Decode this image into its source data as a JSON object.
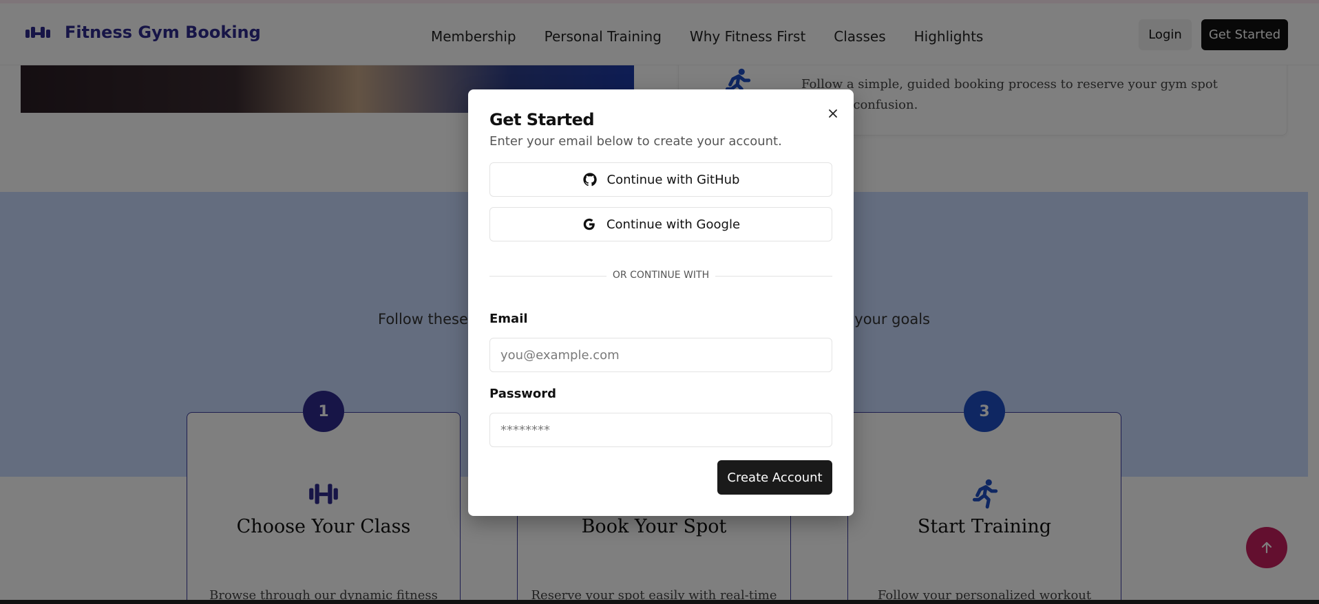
{
  "header": {
    "brand_name": "Fitness Gym Booking",
    "nav": [
      "Membership",
      "Personal Training",
      "Why Fitness First",
      "Classes",
      "Highlights"
    ],
    "login_label": "Login",
    "get_started_label": "Get Started"
  },
  "feature": {
    "text": "Follow a simple, guided booking process to reserve your gym spot without confusion."
  },
  "steps_section": {
    "subtitle_left": "Follow these",
    "subtitle_right": "your goals",
    "steps": [
      {
        "number": "1",
        "title": "Choose Your Class",
        "description": "Browse through our dynamic fitness"
      },
      {
        "number": "",
        "title": "Book Your Spot",
        "description": "Reserve your spot easily with real-time"
      },
      {
        "number": "3",
        "title": "Start Training",
        "description": "Follow your personalized workout"
      }
    ]
  },
  "modal": {
    "title": "Get Started",
    "subtitle": "Enter your email below to create your account.",
    "github_label": "Continue with GitHub",
    "google_label": "Continue with Google",
    "divider_label": "OR CONTINUE WITH",
    "email_label": "Email",
    "email_placeholder": "you@example.com",
    "password_label": "Password",
    "password_placeholder": "********",
    "create_label": "Create Account"
  },
  "colors": {
    "brand": "#2e2a8f",
    "accent_pink": "#c61f5e",
    "section_blue": "#c8dbff",
    "button_dark": "#1a1a1a"
  },
  "icons": [
    "dumbbell-icon",
    "close-icon",
    "github-icon",
    "google-icon",
    "running-icon",
    "arrow-up-icon"
  ]
}
